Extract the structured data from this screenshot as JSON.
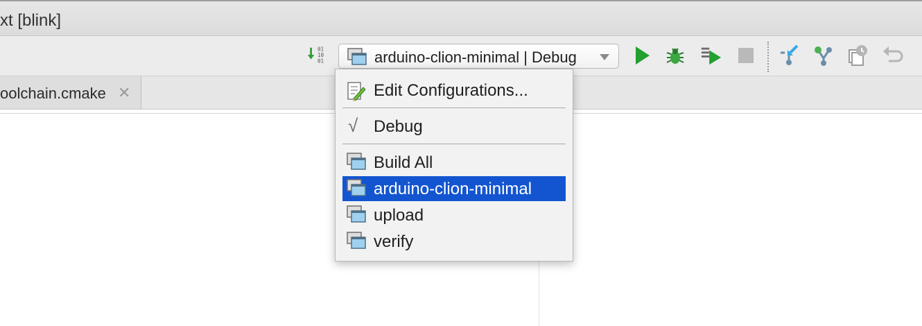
{
  "window": {
    "title": "xt [blink]"
  },
  "toolbar": {
    "run_config": "arduino-clion-minimal | Debug",
    "icons": [
      "build-project-icon",
      "run-icon",
      "debug-icon",
      "run-with-coverage-icon",
      "stop-icon",
      "vcs-update-icon",
      "vcs-commit-icon",
      "vcs-history-icon",
      "revert-icon"
    ]
  },
  "tabs": [
    {
      "label": "oolchain.cmake",
      "close_icon": "close-icon"
    }
  ],
  "dropdown": {
    "edit_configurations": "Edit Configurations...",
    "build_type": "Debug",
    "build_type_checked": true,
    "targets": [
      {
        "label": "Build All",
        "selected": false
      },
      {
        "label": "arduino-clion-minimal",
        "selected": true
      },
      {
        "label": "upload",
        "selected": false
      },
      {
        "label": "verify",
        "selected": false
      }
    ]
  },
  "colors": {
    "selection": "#1355d0",
    "run_green": "#22a030",
    "popup_bg": "#f2f2f2",
    "toolbar_bg": "#ececec"
  }
}
